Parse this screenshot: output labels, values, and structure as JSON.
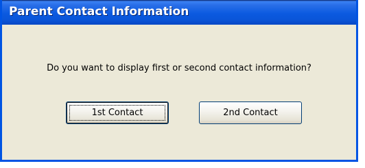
{
  "dialog": {
    "title": "Parent Contact Information",
    "message": "Do you want to display first or second contact information?",
    "buttons": {
      "first_label": "1st Contact",
      "second_label": "2nd Contact"
    }
  },
  "colors": {
    "titlebar": "#0b5ae0",
    "window_body": "#ece9d8",
    "window_border": "#0054e3"
  }
}
